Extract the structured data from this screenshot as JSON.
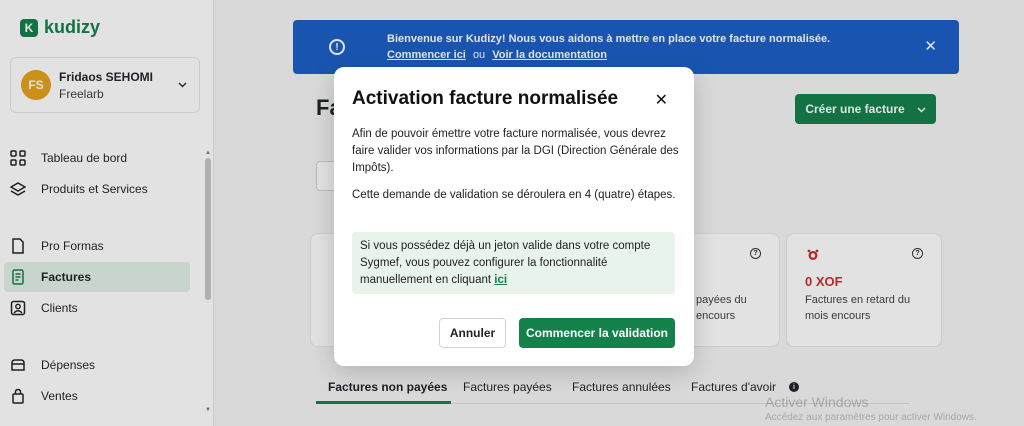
{
  "sidebar": {
    "logo_mark": "K",
    "logo_text": "kudizy",
    "user": {
      "initials": "FS",
      "name": "Fridaos SEHOMI",
      "org": "Freelarb"
    },
    "items": [
      {
        "label": "Tableau de bord",
        "icon": "grid-icon"
      },
      {
        "label": "Produits et Services",
        "icon": "layers-icon"
      },
      {
        "label": "Pro Formas",
        "icon": "document-icon"
      },
      {
        "label": "Factures",
        "icon": "invoice-icon",
        "active": true
      },
      {
        "label": "Clients",
        "icon": "contact-icon"
      },
      {
        "label": "Dépenses",
        "icon": "wallet-icon"
      },
      {
        "label": "Ventes",
        "icon": "bag-icon"
      }
    ]
  },
  "banner": {
    "text": "Bienvenue sur Kudizy! Nous vous aidons à mettre en place votre facture normalisée.",
    "link_start": "Commencer ici",
    "separator": "ou",
    "link_docs": "Voir la documentation"
  },
  "main": {
    "title_visible": "Fa",
    "create_label": "Créer une facture",
    "cards": {
      "b_desc_line1": "payées du",
      "b_desc_line2": "encours",
      "c_amount": "0 XOF",
      "c_desc_line1": "Factures en retard du",
      "c_desc_line2": "mois encours"
    },
    "tabs": [
      "Factures non payées",
      "Factures payées",
      "Factures annulées",
      "Factures d'avoir"
    ]
  },
  "modal": {
    "title": "Activation facture normalisée",
    "p1": "Afin de pouvoir émettre votre facture normalisée, vous devrez faire valider vos informations par la DGI (Direction Générale des Impôts).",
    "p2": "Cette demande de validation se déroulera en 4 (quatre) étapes.",
    "note": "Si vous possédez déjà un jeton valide dans votre compte Sygmef, vous pouvez configurer la fonctionnalité manuellement en cliquant",
    "note_link": "ici",
    "cancel_label": "Annuler",
    "start_label": "Commencer la validation"
  },
  "watermark": {
    "title": "Activer Windows",
    "subtitle": "Accédez aux paramètres pour activer Windows."
  },
  "colors": {
    "brand": "#14804a",
    "banner": "#1b5fc7",
    "danger": "#c9302c"
  }
}
